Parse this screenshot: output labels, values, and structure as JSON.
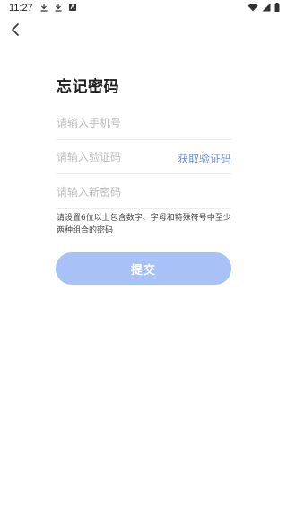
{
  "status_bar": {
    "time": "11:27",
    "left_icons": [
      "download-icon",
      "download-icon",
      "app-notification-icon"
    ],
    "right_icons": [
      "wifi-icon",
      "signal-icon",
      "battery-icon"
    ]
  },
  "header": {
    "back_icon": "chevron-left-icon"
  },
  "page": {
    "title": "忘记密码"
  },
  "form": {
    "phone_placeholder": "请输入手机号",
    "code_placeholder": "请输入验证码",
    "get_code_label": "获取验证码",
    "new_password_placeholder": "请输入新密码",
    "hint": "请设置6位以上包含数字、字母和特殊符号中至少两种组合的密码",
    "submit_label": "提交"
  },
  "colors": {
    "accent": "#6f8fd0",
    "submit_bg": "#a8c1f6",
    "placeholder": "#bdbdbd"
  }
}
